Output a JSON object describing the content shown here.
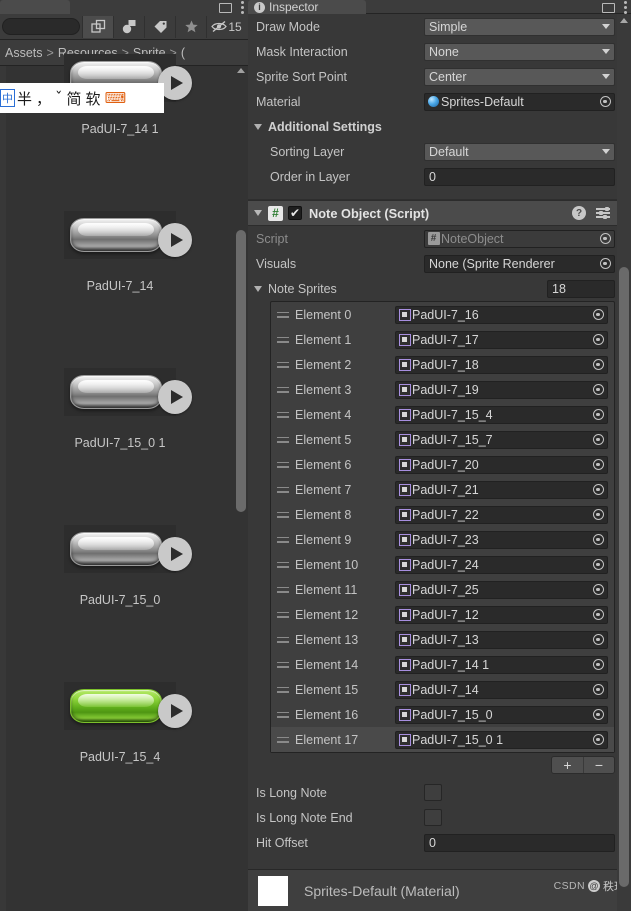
{
  "project": {
    "tab_label": "",
    "breadcrumb": [
      "Assets",
      "Resources",
      "Sprite",
      "("
    ],
    "breadcrumb_sep": ">",
    "toolbar": {
      "search_placeholder": "",
      "search_value": "",
      "icons": [
        "expand-icon",
        "asset-type-icon",
        "label-icon",
        "favorite-star-icon",
        "hidden-eye-icon"
      ],
      "hidden_count": "15"
    },
    "assets": [
      {
        "label": "PadUI-7_14 1",
        "style": "silver"
      },
      {
        "label": "PadUI-7_14",
        "style": "silver"
      },
      {
        "label": "PadUI-7_15_0 1",
        "style": "silver"
      },
      {
        "label": "PadUI-7_15_0",
        "style": "silver"
      },
      {
        "label": "PadUI-7_15_4",
        "style": "green"
      }
    ]
  },
  "ime": {
    "items": [
      "中",
      "半",
      "，",
      "ˇ",
      "简",
      "软",
      "⌨"
    ]
  },
  "inspector": {
    "tab_label": "Inspector",
    "tab_icon": "info-icon",
    "window_icons": [
      "maximize-icon",
      "more-options-icon"
    ],
    "sprite_renderer": {
      "fields": [
        {
          "label": "Draw Mode",
          "value": "Simple",
          "kind": "dropdown"
        },
        {
          "label": "Mask Interaction",
          "value": "None",
          "kind": "dropdown"
        },
        {
          "label": "Sprite Sort Point",
          "value": "Center",
          "kind": "dropdown"
        },
        {
          "label": "Material",
          "value": "Sprites-Default",
          "kind": "object"
        }
      ],
      "additional_settings": {
        "title": "Additional Settings",
        "fields": [
          {
            "label": "Sorting Layer",
            "value": "Default",
            "kind": "dropdown"
          },
          {
            "label": "Order in Layer",
            "value": "0",
            "kind": "text"
          }
        ]
      }
    },
    "note_object": {
      "title": "Note Object (Script)",
      "enabled": true,
      "checkmark": "✔",
      "header_icons": [
        "help-icon",
        "preset-icon",
        "more-options-icon"
      ],
      "script_label": "Script",
      "script_value": "NoteObject",
      "visuals_label": "Visuals",
      "visuals_value": "None (Sprite Renderer",
      "array": {
        "title": "Note Sprites",
        "size": "18",
        "elements": [
          {
            "name": "Element 0",
            "value": "PadUI-7_16"
          },
          {
            "name": "Element 1",
            "value": "PadUI-7_17"
          },
          {
            "name": "Element 2",
            "value": "PadUI-7_18"
          },
          {
            "name": "Element 3",
            "value": "PadUI-7_19"
          },
          {
            "name": "Element 4",
            "value": "PadUI-7_15_4"
          },
          {
            "name": "Element 5",
            "value": "PadUI-7_15_7"
          },
          {
            "name": "Element 6",
            "value": "PadUI-7_20"
          },
          {
            "name": "Element 7",
            "value": "PadUI-7_21"
          },
          {
            "name": "Element 8",
            "value": "PadUI-7_22"
          },
          {
            "name": "Element 9",
            "value": "PadUI-7_23"
          },
          {
            "name": "Element 10",
            "value": "PadUI-7_24"
          },
          {
            "name": "Element 11",
            "value": "PadUI-7_25"
          },
          {
            "name": "Element 12",
            "value": "PadUI-7_12"
          },
          {
            "name": "Element 13",
            "value": "PadUI-7_13"
          },
          {
            "name": "Element 14",
            "value": "PadUI-7_14 1"
          },
          {
            "name": "Element 15",
            "value": "PadUI-7_14"
          },
          {
            "name": "Element 16",
            "value": "PadUI-7_15_0"
          },
          {
            "name": "Element 17",
            "value": "PadUI-7_15_0 1"
          }
        ],
        "add_label": "+",
        "remove_label": "−"
      },
      "toggles": [
        {
          "label": "Is Long Note",
          "checked": false
        },
        {
          "label": "Is Long Note End",
          "checked": false
        }
      ],
      "hit_offset_label": "Hit Offset",
      "hit_offset_value": "0"
    },
    "material_preview": {
      "title": "Sprites-Default (Material)",
      "swatch_color": "#ffffff"
    }
  },
  "watermark": {
    "site": "CSDN",
    "at": "@",
    "handle": "秩玩"
  },
  "theme": {
    "bg": "#383838",
    "panel": "#3c3c3c",
    "field": "#2a2a2a",
    "dropdown": "#585858",
    "header": "#4b4b4b",
    "text": "#c4c4c4"
  }
}
